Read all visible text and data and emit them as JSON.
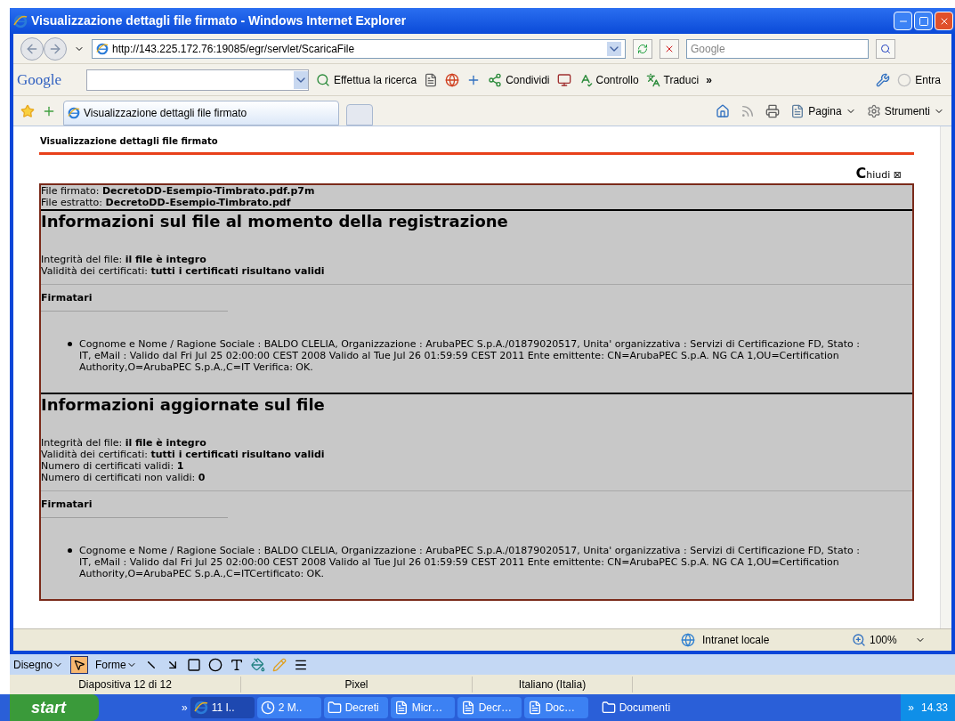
{
  "window": {
    "title": "Visualizzazione dettagli file firmato - Windows Internet Explorer"
  },
  "address_bar": {
    "url": "http://143.225.172.76:19085/egr/servlet/ScaricaFile",
    "search_placeholder": "Google"
  },
  "google_toolbar": {
    "logo": "Google",
    "items": [
      {
        "label": "Effettua la ricerca",
        "kind": "search"
      },
      {
        "label": "Condividi",
        "kind": "share"
      },
      {
        "label": "Controllo",
        "kind": "check"
      },
      {
        "label": "Traduci",
        "kind": "translate"
      }
    ],
    "more": "»",
    "sign_in": "Entra"
  },
  "tabs": [
    {
      "title": "Visualizzazione dettagli file firmato",
      "selected": true
    }
  ],
  "command_bar": [
    "Pagina",
    "Strumenti"
  ],
  "page": {
    "header": "Visualizzazione dettagli file firmato",
    "close_label": "Chiudi",
    "close_glyph": "⊠",
    "files": [
      {
        "label": "File firmato: ",
        "value": "DecretoDD-Esempio-Timbrato.pdf.p7m"
      },
      {
        "label": "File estratto: ",
        "value": "DecretoDD-Esempio-Timbrato.pdf"
      }
    ],
    "sections": [
      {
        "title": "Informazioni sul file al momento della registrazione",
        "fields": [
          {
            "label": "Integrità del file: ",
            "value": "il file è integro"
          },
          {
            "label": "Validità dei certificati: ",
            "value": "tutti i certificati risultano validi"
          }
        ],
        "signers_heading": "Firmatari",
        "signers": [
          "Cognome e Nome / Ragione Sociale : BALDO CLELIA, Organizzazione : ArubaPEC S.p.A./01879020517, Unita' organizzativa : Servizi di Certificazione FD, Stato : IT, eMail : Valido dal Fri Jul 25 02:00:00 CEST 2008 Valido al Tue Jul 26 01:59:59 CEST 2011 Ente emittente: CN=ArubaPEC S.p.A. NG CA 1,OU=Certification Authority,O=ArubaPEC S.p.A.,C=IT Verifica: OK."
        ]
      },
      {
        "title": "Informazioni aggiornate sul file",
        "fields": [
          {
            "label": "Integrità del file: ",
            "value": "il file è integro"
          },
          {
            "label": "Validità dei certificati: ",
            "value": "tutti i certificati risultano validi"
          },
          {
            "label": "Numero di certificati validi: ",
            "value": "1"
          },
          {
            "label": "Numero di certificati non validi: ",
            "value": "0"
          }
        ],
        "signers_heading": "Firmatari",
        "signers": [
          "Cognome e Nome / Ragione Sociale : BALDO CLELIA, Organizzazione : ArubaPEC S.p.A./01879020517, Unita' organizzativa : Servizi di Certificazione FD, Stato : IT, eMail : Valido dal Fri Jul 25 02:00:00 CEST 2008 Valido al Tue Jul 26 01:59:59 CEST 2011 Ente emittente: CN=ArubaPEC S.p.A. NG CA 1,OU=Certification Authority,O=ArubaPEC S.p.A.,C=ITCertificato: OK."
        ]
      }
    ]
  },
  "ie_status": {
    "zone": "Intranet locale",
    "zoom": "100%"
  },
  "drawing_toolbar": {
    "menus": [
      "Disegno",
      "Forme"
    ]
  },
  "app_status": [
    "Diapositiva 12 di 12",
    "Pixel",
    "Italiano (Italia)"
  ],
  "taskbar": {
    "start": "start",
    "quick_more": "»",
    "buttons": [
      {
        "label": "11 I..",
        "selected": true,
        "kind": "ie"
      },
      {
        "label": "2 M..",
        "selected": false,
        "kind": "clock"
      },
      {
        "label": "Decreti",
        "selected": false,
        "kind": "folder"
      },
      {
        "label": "Micr…",
        "selected": false,
        "kind": "ppt"
      },
      {
        "label": "Decr…",
        "selected": false,
        "kind": "pdf"
      },
      {
        "label": "Doc…",
        "selected": false,
        "kind": "doc"
      }
    ],
    "toolbar_label": "Documenti",
    "tray_more": "»",
    "clock": "14.33"
  }
}
